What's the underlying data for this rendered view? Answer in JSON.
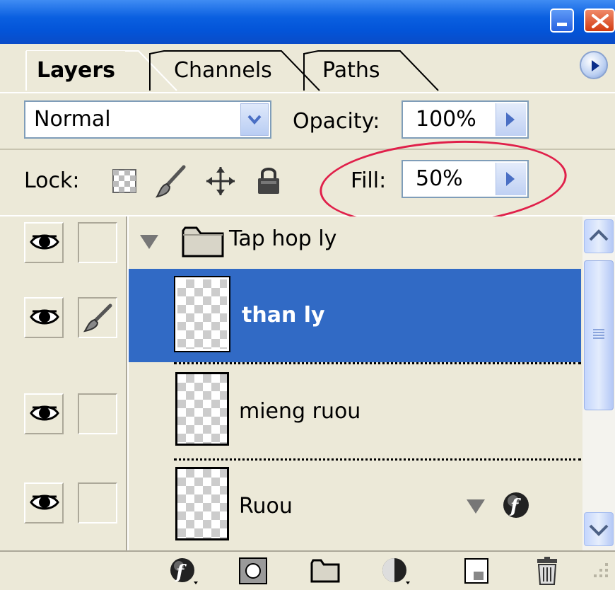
{
  "tabs": [
    {
      "label": "Layers",
      "active": true
    },
    {
      "label": "Channels",
      "active": false
    },
    {
      "label": "Paths",
      "active": false
    }
  ],
  "blend_mode": {
    "value": "Normal"
  },
  "opacity": {
    "label": "Opacity:",
    "value": "100%"
  },
  "lock": {
    "label": "Lock:"
  },
  "fill": {
    "label": "Fill:",
    "value": "50%"
  },
  "layers": [
    {
      "name": "Tap hop ly",
      "type": "group",
      "expanded": true,
      "visible": true
    },
    {
      "name": "than ly",
      "type": "layer",
      "selected": true,
      "visible": true,
      "brush_linked": true
    },
    {
      "name": "mieng ruou",
      "type": "layer",
      "selected": false,
      "visible": true
    },
    {
      "name": "Ruou",
      "type": "layer",
      "selected": false,
      "visible": true,
      "has_effects": true
    }
  ],
  "colors": {
    "selection": "#316ac5",
    "highlight_ellipse": "#e0204a",
    "titlebar": "#0a5fe0"
  },
  "icons": {
    "lock": [
      "lock-transparency-icon",
      "lock-image-brush-icon",
      "lock-position-move-icon",
      "lock-all-padlock-icon"
    ],
    "bottom": [
      "layer-style-fx-icon",
      "layer-mask-icon",
      "new-group-folder-icon",
      "adjustment-layer-icon",
      "new-layer-icon",
      "trash-icon"
    ]
  }
}
